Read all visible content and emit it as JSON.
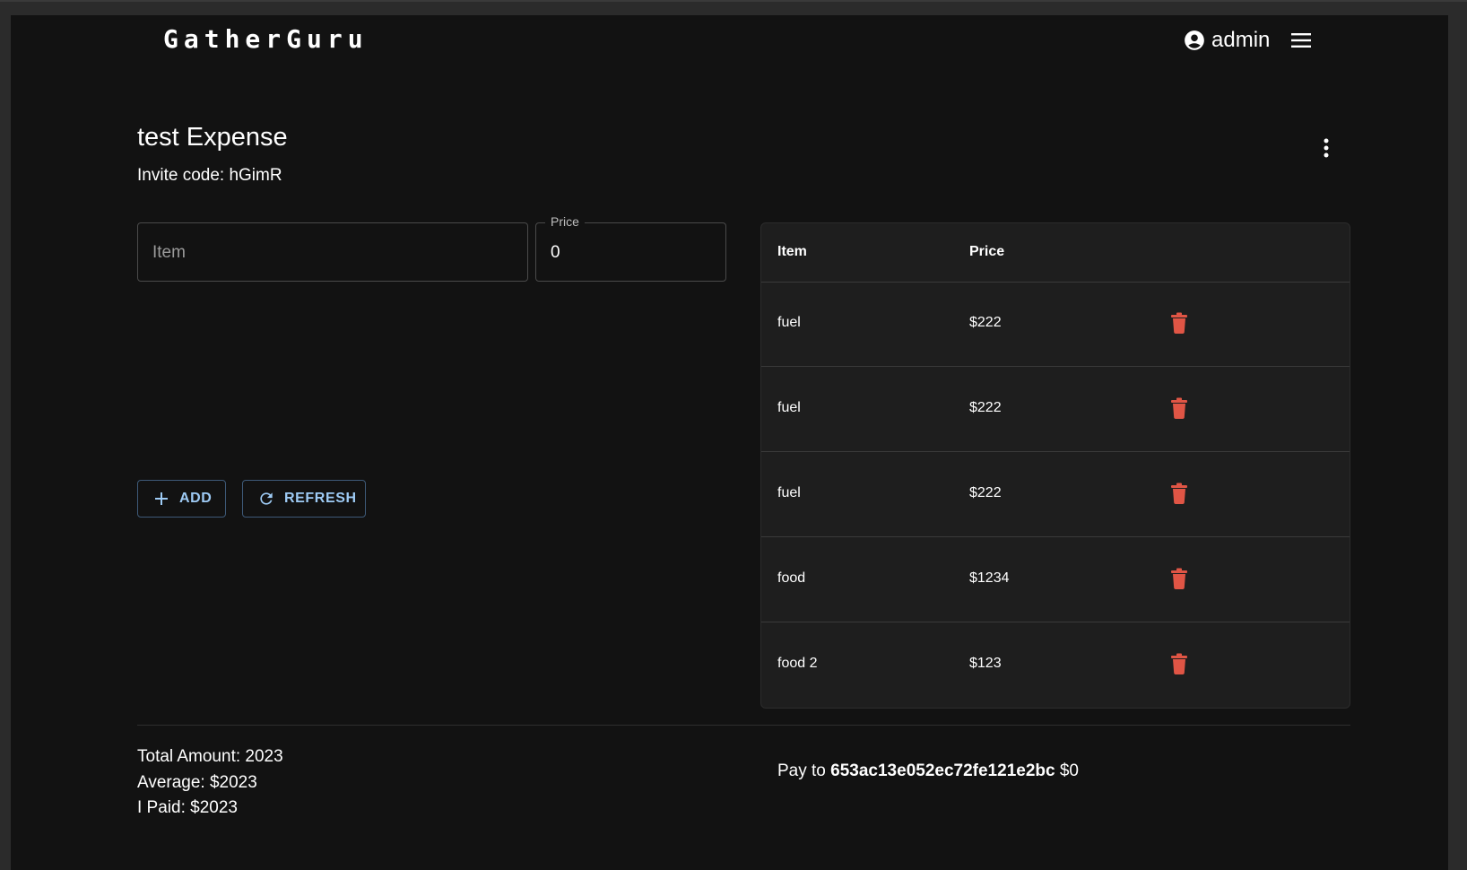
{
  "header": {
    "brand": "GatherGuru",
    "user": "admin"
  },
  "expense": {
    "title": "test Expense",
    "invite": "Invite code: hGimR"
  },
  "form": {
    "item_placeholder": "Item",
    "price_label": "Price",
    "price_value": "0",
    "add_label": "ADD",
    "refresh_label": "REFRESH"
  },
  "table": {
    "headers": [
      "Item",
      "Price"
    ],
    "rows": [
      {
        "item": "fuel",
        "price": "$222"
      },
      {
        "item": "fuel",
        "price": "$222"
      },
      {
        "item": "fuel",
        "price": "$222"
      },
      {
        "item": "food",
        "price": "$1234"
      },
      {
        "item": "food 2",
        "price": "$123"
      }
    ]
  },
  "summary": {
    "total": "Total Amount: 2023",
    "average": "Average: $2023",
    "paid": "I Paid: $2023"
  },
  "payment": {
    "prefix": "Pay to ",
    "payee": "653ac13e052ec72fe121e2bc",
    "amount": "$0"
  },
  "colors": {
    "background": "#121212",
    "table_bg": "#1e1e1e",
    "accent": "#9ecbf5",
    "delete": "#e05545"
  },
  "icons": {
    "user": "account-circle-icon",
    "menu": "hamburger-menu-icon",
    "more": "more-vert-icon",
    "add": "plus-icon",
    "refresh": "refresh-icon",
    "delete": "trash-icon"
  }
}
